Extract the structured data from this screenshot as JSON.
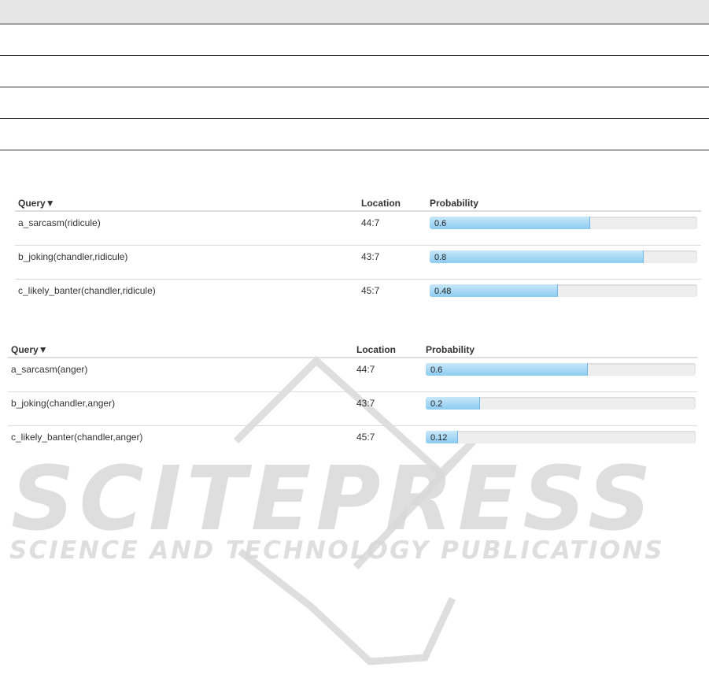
{
  "top_table": {
    "row_count": 4
  },
  "tables": [
    {
      "headers": {
        "query": "Query",
        "sort_icon": "▼",
        "location": "Location",
        "probability": "Probability"
      },
      "rows": [
        {
          "query": "a_sarcasm(ridicule)",
          "location": "44:7",
          "probability": 0.6,
          "probability_label": "0.6"
        },
        {
          "query": "b_joking(chandler,ridicule)",
          "location": "43:7",
          "probability": 0.8,
          "probability_label": "0.8"
        },
        {
          "query": "c_likely_banter(chandler,ridicule)",
          "location": "45:7",
          "probability": 0.48,
          "probability_label": "0.48"
        }
      ]
    },
    {
      "headers": {
        "query": "Query",
        "sort_icon": "▼",
        "location": "Location",
        "probability": "Probability"
      },
      "rows": [
        {
          "query": "a_sarcasm(anger)",
          "location": "44:7",
          "probability": 0.6,
          "probability_label": "0.6"
        },
        {
          "query": "b_joking(chandler,anger)",
          "location": "43:7",
          "probability": 0.2,
          "probability_label": "0.2"
        },
        {
          "query": "c_likely_banter(chandler,anger)",
          "location": "45:7",
          "probability": 0.12,
          "probability_label": "0.12"
        }
      ]
    }
  ],
  "watermark": {
    "title": "SCITEPRESS",
    "subtitle": "SCIENCE AND TECHNOLOGY PUBLICATIONS"
  }
}
